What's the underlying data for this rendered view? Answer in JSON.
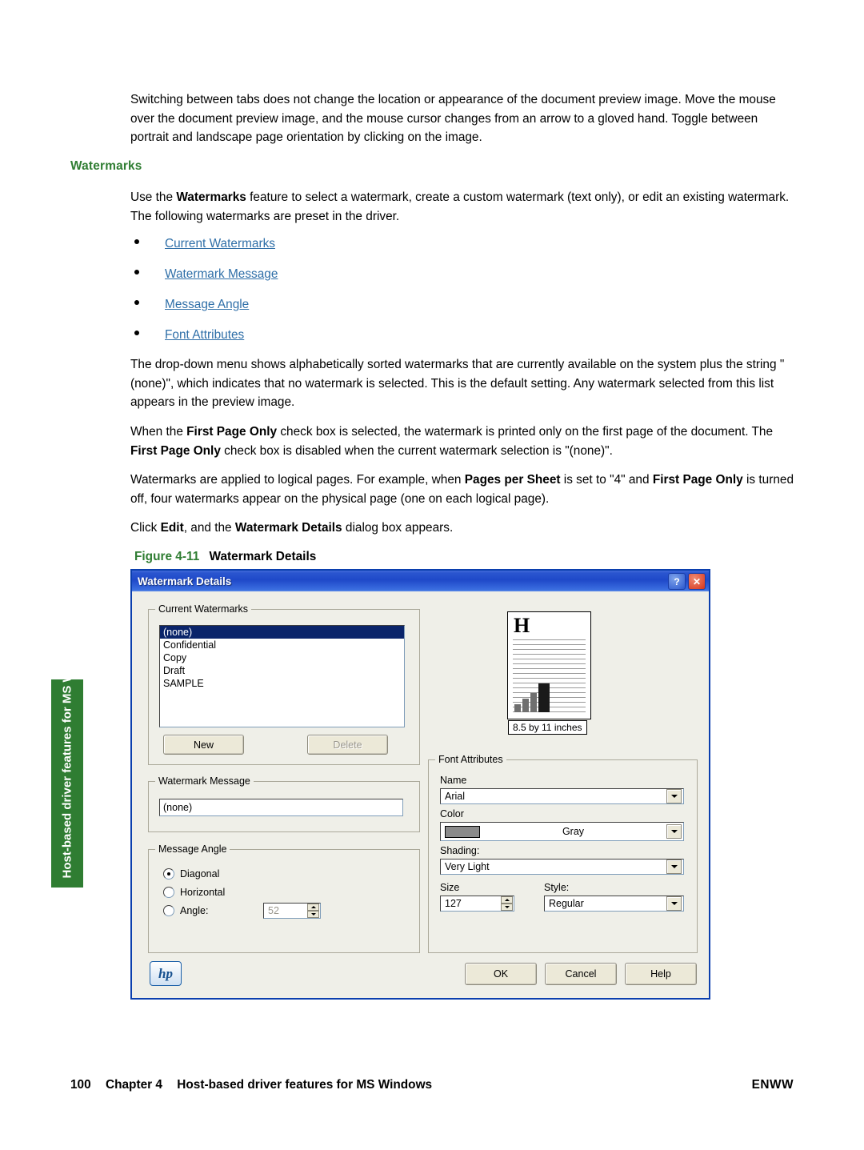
{
  "body": {
    "intro": "Switching between tabs does not change the location or appearance of the document preview image. Move the mouse over the document preview image, and the mouse cursor changes from an arrow to a gloved hand. Toggle between portrait and landscape page orientation by clicking on the image.",
    "section_heading": "Watermarks",
    "p1_a": "Use the ",
    "p1_b": "Watermarks",
    "p1_c": " feature to select a watermark, create a custom watermark (text only), or edit an existing watermark. The following watermarks are preset in the driver.",
    "links": [
      "Current Watermarks",
      "Watermark Message",
      "Message Angle",
      "Font Attributes"
    ],
    "p2": "The drop-down menu shows alphabetically sorted watermarks that are currently available on the system plus the string \"(none)\", which indicates that no watermark is selected. This is the default setting. Any watermark selected from this list appears in the preview image.",
    "p3_a": "When the ",
    "p3_b": "First Page Only",
    "p3_c": " check box is selected, the watermark is printed only on the first page of the document. The ",
    "p3_d": "First Page Only",
    "p3_e": " check box is disabled when the current watermark selection is \"(none)\".",
    "p4_a": "Watermarks are applied to logical pages. For example, when ",
    "p4_b": "Pages per Sheet",
    "p4_c": " is set to \"4\" and ",
    "p4_d": "First Page Only",
    "p4_e": " is turned off, four watermarks appear on the physical page (one on each logical page).",
    "p5_a": "Click ",
    "p5_b": "Edit",
    "p5_c": ", and the ",
    "p5_d": "Watermark Details",
    "p5_e": " dialog box appears.",
    "figure_number": "Figure 4-11",
    "figure_title": "Watermark Details"
  },
  "sidetab": {
    "label": "Host-based driver features for MS Windows"
  },
  "footer": {
    "page_number": "100",
    "chapter": "Chapter 4",
    "chapter_title": "Host-based driver features for MS Windows",
    "right": "ENWW"
  },
  "dialog": {
    "title": "Watermark Details",
    "help_button": "?",
    "close_button": "✕",
    "current_watermarks": {
      "legend": "Current Watermarks",
      "items": [
        "(none)",
        "Confidential",
        "Copy",
        "Draft",
        "SAMPLE"
      ],
      "selected_index": 0,
      "new_button": "New",
      "delete_button": "Delete"
    },
    "watermark_message": {
      "legend": "Watermark Message",
      "value": "(none)"
    },
    "message_angle": {
      "legend": "Message Angle",
      "options": [
        "Diagonal",
        "Horizontal",
        "Angle:"
      ],
      "selected_index": 0,
      "angle_value": "52"
    },
    "preview": {
      "letter": "H",
      "size_caption": "8.5 by 11 inches"
    },
    "font_attributes": {
      "legend": "Font Attributes",
      "name_label": "Name",
      "name_value": "Arial",
      "color_label": "Color",
      "color_value": "Gray",
      "color_swatch": "#8a8a8a",
      "shading_label": "Shading:",
      "shading_value": "Very Light",
      "size_label": "Size",
      "size_value": "127",
      "style_label": "Style:",
      "style_value": "Regular"
    },
    "buttons": {
      "ok": "OK",
      "cancel": "Cancel",
      "help": "Help"
    },
    "logo": "hp"
  }
}
